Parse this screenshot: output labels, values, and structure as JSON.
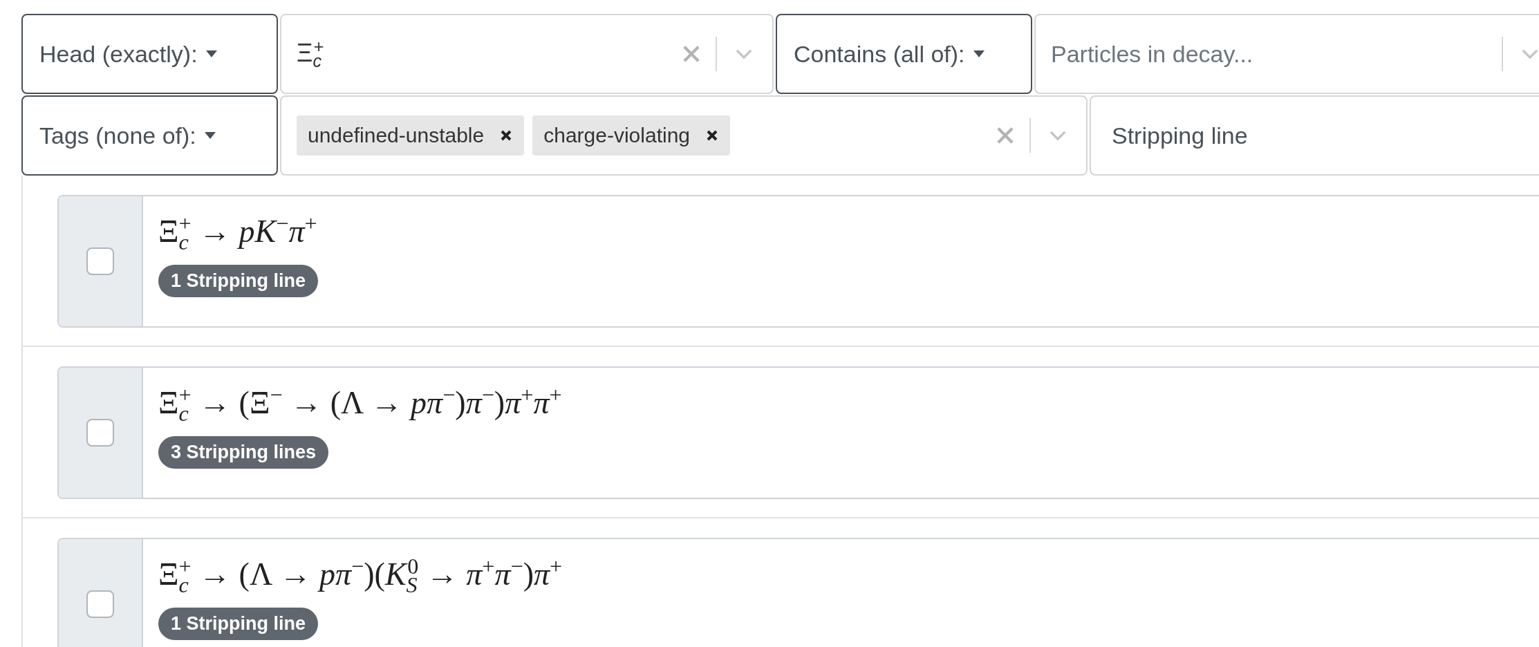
{
  "filters": [
    {
      "mode": "Head (exactly):",
      "field": {
        "kind": "single",
        "value": "Ξ$_{c}$$^{+}$",
        "clearable": true
      }
    },
    {
      "mode": "Contains (all of):",
      "field": {
        "kind": "single",
        "placeholder": "Particles in decay...",
        "clearable": false
      }
    },
    {
      "mode": "Tags (none of):",
      "field": {
        "kind": "multi",
        "tags": [
          "undefined-unstable",
          "charge-violating"
        ],
        "clearable": true
      }
    },
    {
      "field": {
        "kind": "text",
        "placeholder": "Stripping line"
      }
    }
  ],
  "decays": [
    {
      "checked": false,
      "formula": "Ξ$_{c}$$^{+}$ → *pK*$^{−}$*π*$^{+}$",
      "badge": "1 Stripping line"
    },
    {
      "checked": false,
      "formula": "Ξ$_{c}$$^{+}$ → (Ξ$^{−}$ → (Λ → *pπ*$^{−}$)*π*$^{−}$)*π*$^{+}$*π*$^{+}$",
      "badge": "3 Stripping lines"
    },
    {
      "checked": false,
      "formula": "Ξ$_{c}$$^{+}$ → (Λ → *pπ*$^{−}$)(*K*$_{S}$$^{0}$ → *π*$^{+}$*π*$^{−}$)*π*$^{+}$",
      "badge": "1 Stripping line"
    }
  ]
}
